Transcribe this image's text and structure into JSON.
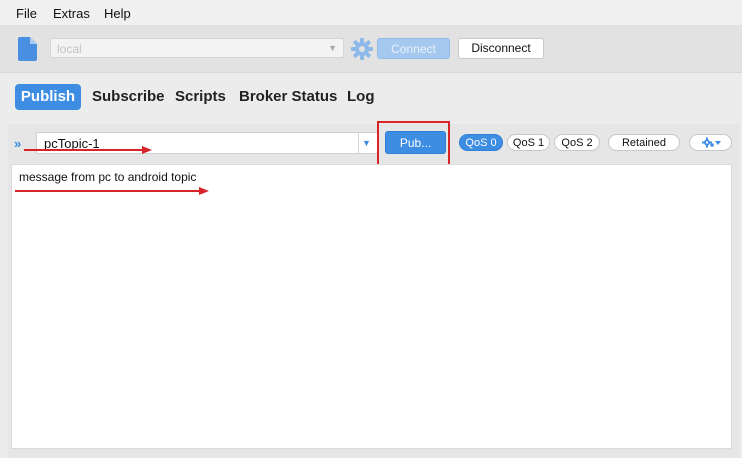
{
  "menubar": {
    "items": [
      "File",
      "Extras",
      "Help"
    ]
  },
  "toolbar": {
    "connection_value": "local",
    "connect_label": "Connect",
    "disconnect_label": "Disconnect",
    "connect_enabled": false
  },
  "tabs": [
    "Publish",
    "Subscribe",
    "Scripts",
    "Broker Status",
    "Log"
  ],
  "active_tab": "Publish",
  "publish": {
    "topic_value": "pcTopic-1",
    "publish_label": "Pub...",
    "qos_options": [
      "QoS 0",
      "QoS 1",
      "QoS 2"
    ],
    "selected_qos": "QoS 0",
    "retained_label": "Retained",
    "message_text": "message from pc to android topic"
  },
  "colors": {
    "accent": "#3d8de3",
    "annotation": "#d9232a",
    "background": "#ececec"
  },
  "icons": [
    "file-icon",
    "gear-icon",
    "chevron-double-right-icon",
    "settings-dropdown-icon",
    "chevron-down-icon"
  ]
}
